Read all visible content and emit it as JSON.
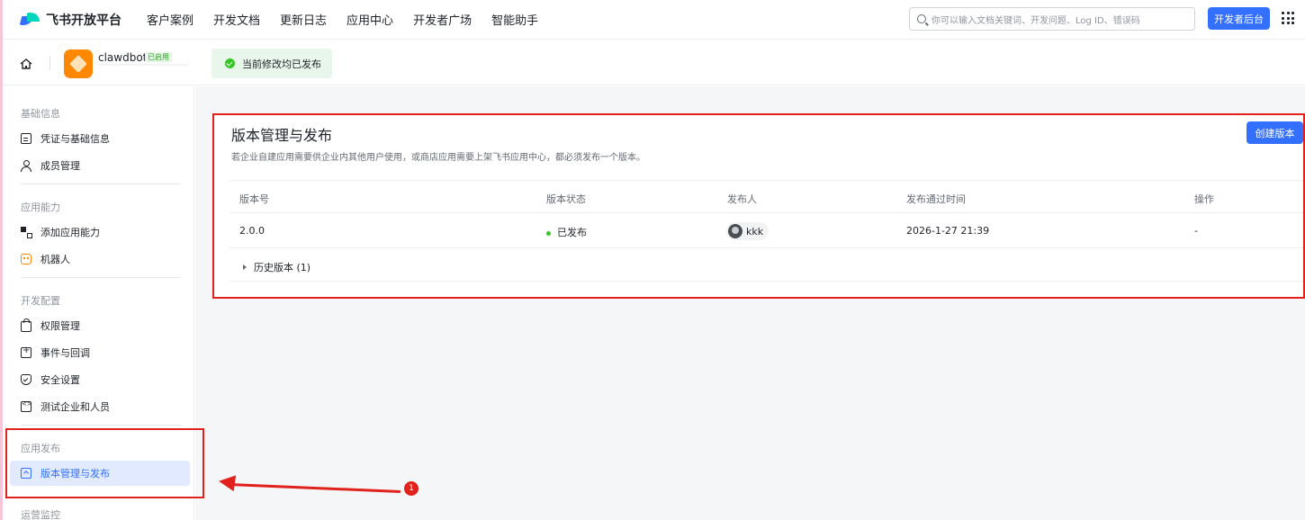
{
  "topnav": {
    "logo_text": "飞书开放平台",
    "items": [
      "客户案例",
      "开发文档",
      "更新日志",
      "应用中心",
      "开发者广场",
      "智能助手"
    ],
    "search_placeholder": "你可以输入文档关键词、开发问题、Log ID、错误码",
    "dev_console_label": "开发者后台"
  },
  "appbar": {
    "app_name": "clawdbot",
    "app_badge": "已启用",
    "status_text": "当前修改均已发布"
  },
  "sidebar": {
    "groups": [
      {
        "label": "基础信息",
        "items": [
          "凭证与基础信息",
          "成员管理"
        ]
      },
      {
        "label": "应用能力",
        "items": [
          "添加应用能力",
          "机器人"
        ]
      },
      {
        "label": "开发配置",
        "items": [
          "权限管理",
          "事件与回调",
          "安全设置",
          "测试企业和人员"
        ]
      },
      {
        "label": "应用发布",
        "items": [
          "版本管理与发布"
        ]
      },
      {
        "label": "运营监控",
        "items": []
      }
    ],
    "active_item": "版本管理与发布"
  },
  "main": {
    "title": "版本管理与发布",
    "description": "若企业自建应用需要供企业内其他用户使用，或商店应用需要上架飞书应用中心，都必须发布一个版本。",
    "create_button": "创建版本",
    "table": {
      "headers": [
        "版本号",
        "版本状态",
        "发布人",
        "发布通过时间",
        "操作"
      ],
      "rows": [
        {
          "version": "2.0.0",
          "status": "已发布",
          "publisher": "kkk",
          "time": "2026-1-27 21:39",
          "action": "-"
        }
      ]
    },
    "history_label": "历史版本 (1)"
  },
  "annotation": {
    "marker_label": "1",
    "color": "#e0211c"
  },
  "colors": {
    "accent": "#3370ff",
    "success": "#34c724",
    "app_icon": "#ff8800"
  }
}
